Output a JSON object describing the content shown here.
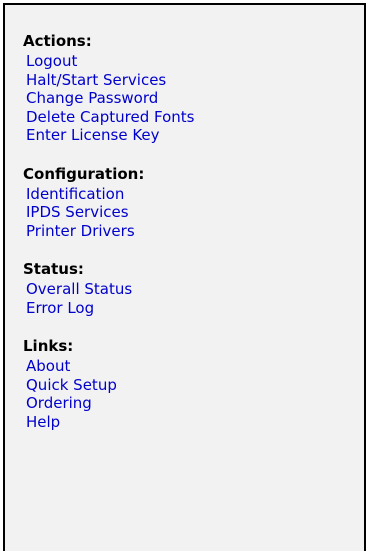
{
  "sections": [
    {
      "heading": "Actions:",
      "links": [
        "Logout",
        "Halt/Start Services",
        "Change Password",
        "Delete Captured Fonts",
        "Enter License Key"
      ]
    },
    {
      "heading": "Configuration:",
      "links": [
        "Identification",
        "IPDS Services",
        "Printer Drivers"
      ]
    },
    {
      "heading": "Status:",
      "links": [
        "Overall Status",
        "Error Log"
      ]
    },
    {
      "heading": "Links:",
      "links": [
        "About",
        "Quick Setup",
        "Ordering",
        "Help"
      ]
    }
  ],
  "colors": {
    "link": "#0000cc",
    "heading": "#000000",
    "panel_background": "#f2f2f2",
    "border": "#000000"
  }
}
